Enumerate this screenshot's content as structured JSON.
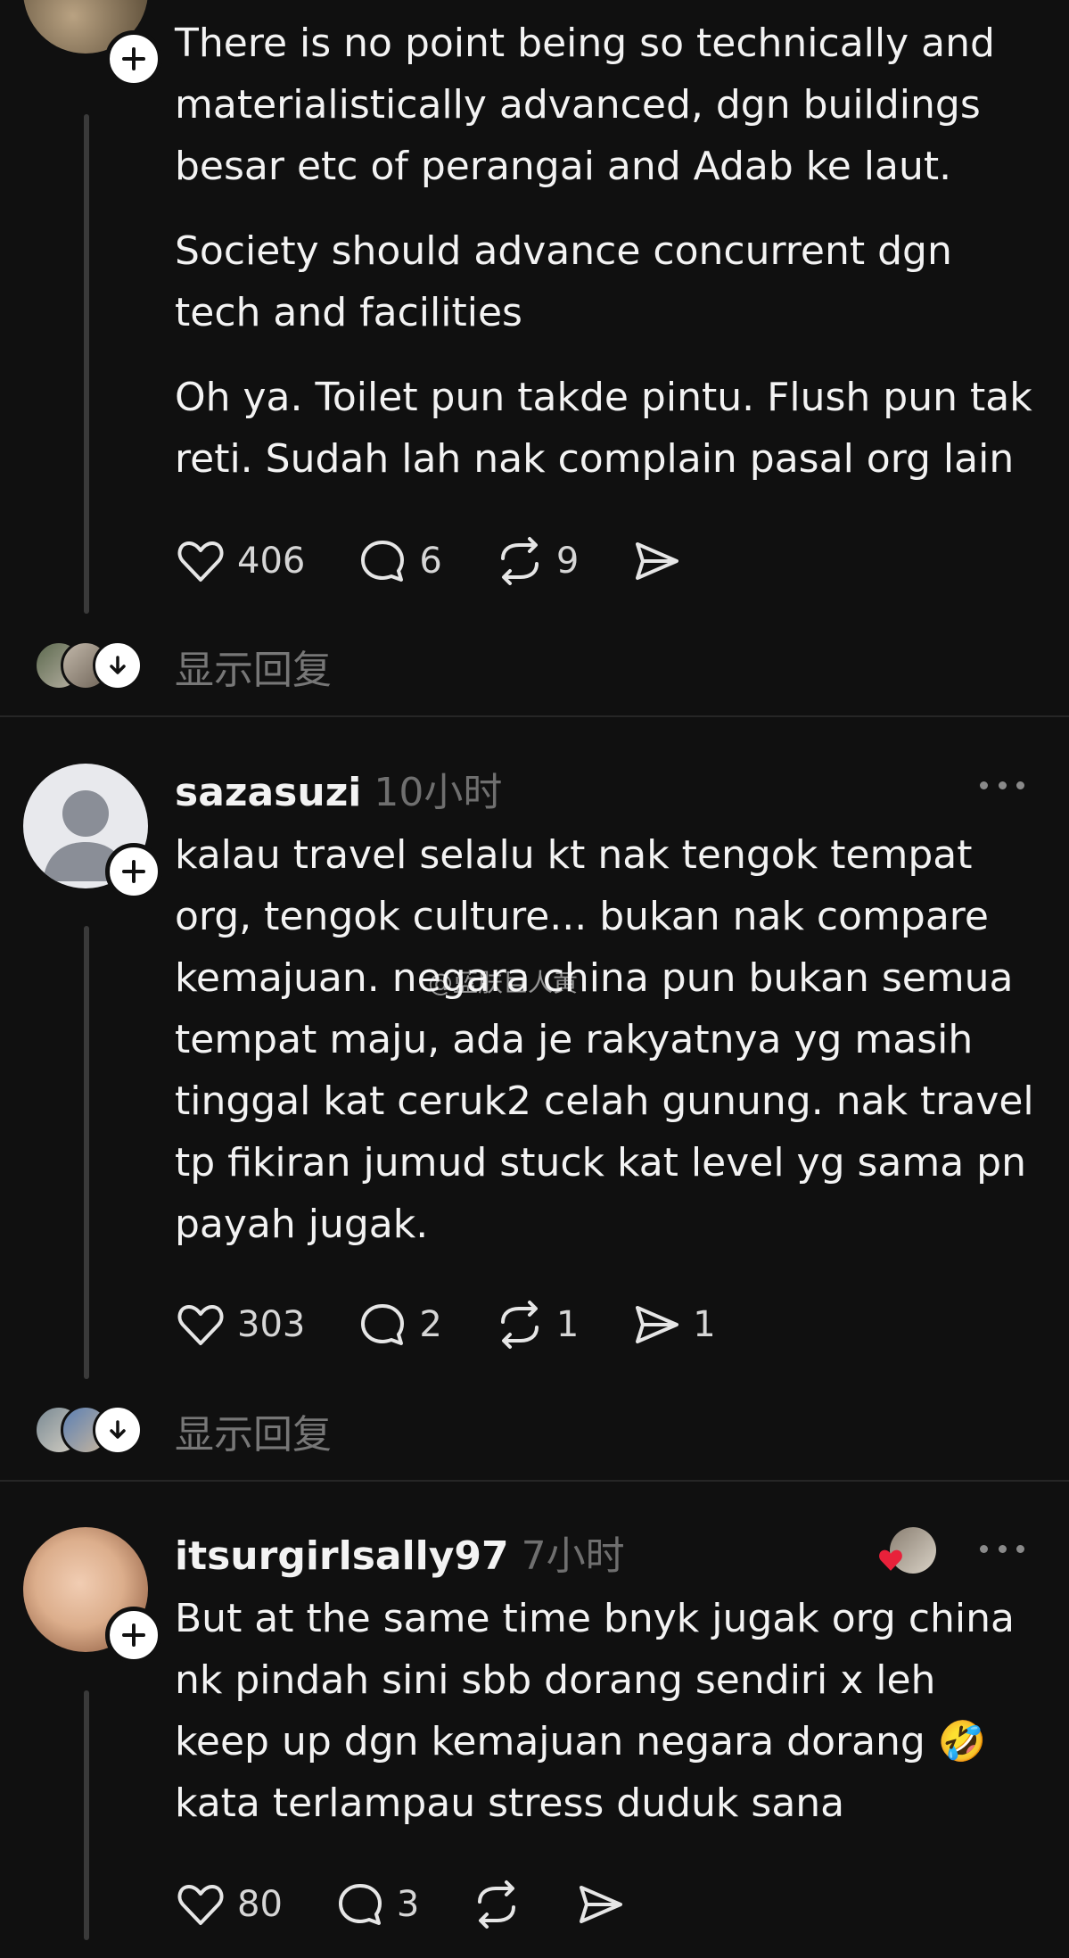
{
  "post1": {
    "paragraphs": [
      "There is no point being so technically and materialistically advanced, dgn buildings besar etc of perangai and Adab ke laut.",
      "Society should advance concurrent dgn tech and facilities",
      "Oh ya. Toilet pun takde pintu. Flush pun tak reti. Sudah lah nak complain pasal org lain"
    ],
    "likes": "406",
    "replies": "6",
    "reposts": "9",
    "show_replies": "显示回复"
  },
  "post2": {
    "username": "sazasuzi",
    "time": "10小时",
    "text": "kalau travel selalu kt nak tengok tempat org, tengok culture... bukan nak compare kemajuan. negara china pun bukan semua tempat maju, ada je rakyatnya yg masih tinggal kat ceruk2 celah gunung. nak travel tp fikiran jumud stuck kat level yg sama pn payah jugak.",
    "likes": "303",
    "replies": "2",
    "reposts": "1",
    "shares": "1",
    "show_replies": "显示回复"
  },
  "post3": {
    "username": "itsurgirlsally97",
    "time": "7小时",
    "text": "But at the same time bnyk jugak org china nk pindah sini sbb dorang sendiri x leh keep up dgn kemajuan negara dorang 🤣 kata terlampau stress duduk sana",
    "likes": "80",
    "replies": "3"
  },
  "watermark": "@蓝肤巨人黄",
  "colors": {
    "background": "#101010",
    "text": "#f3f3f3",
    "muted": "#6f6f6f",
    "heart": "#e8213a"
  },
  "icons": [
    "plus-icon",
    "heart-icon",
    "comment-icon",
    "repost-icon",
    "share-icon",
    "more-icon",
    "chevron-down-icon"
  ]
}
